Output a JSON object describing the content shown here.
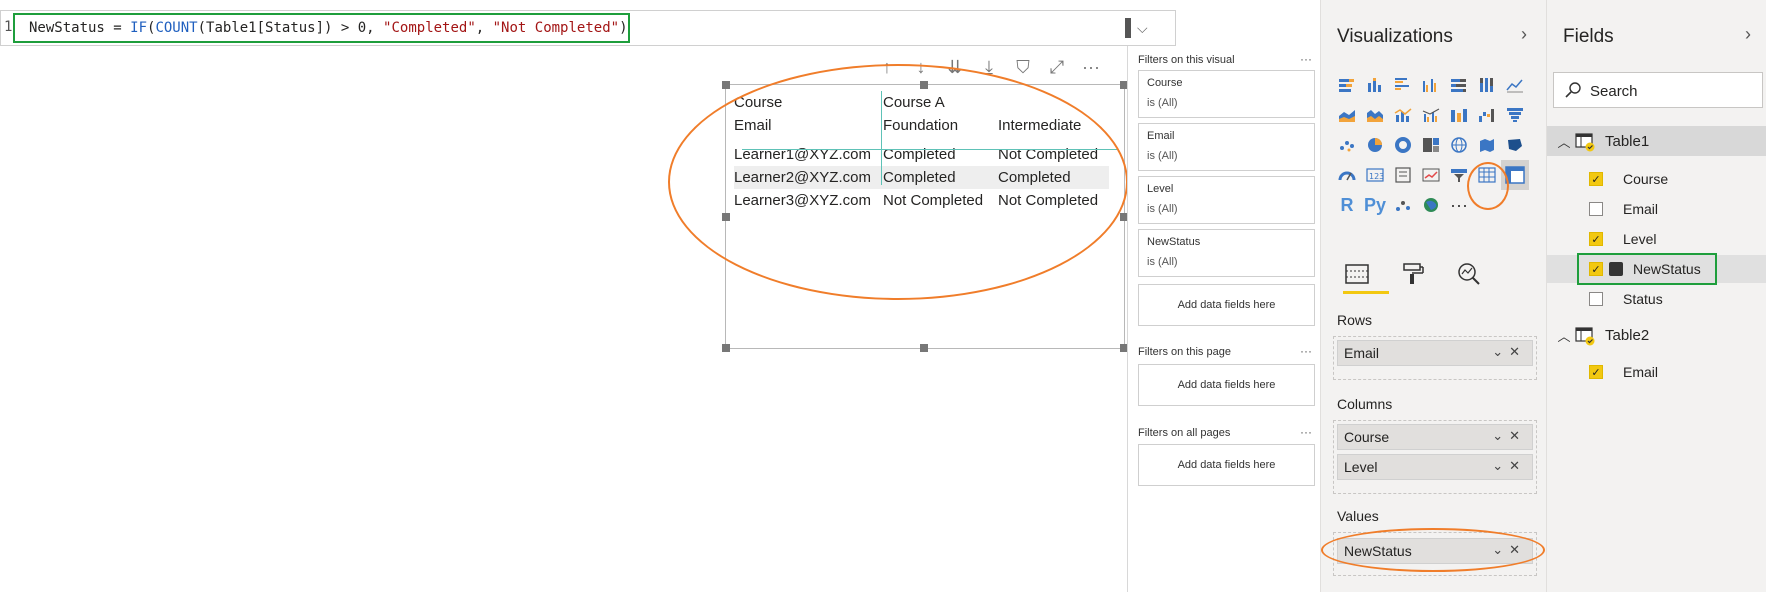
{
  "formula": {
    "line_number": "1",
    "measure_name": "NewStatus",
    "equals": " = ",
    "fn_if": "IF",
    "paren_open": "(",
    "fn_count": "COUNT",
    "count_arg": "(Table1[Status]) > 0, ",
    "str_completed": "\"Completed\"",
    "comma": ", ",
    "str_not_completed": "\"Not Completed\"",
    "paren_close": ")"
  },
  "visual_toolbar": {
    "icons": [
      "arrow-up-icon",
      "arrow-down-icon",
      "double-arrow-down-icon",
      "expand-down-icon",
      "filter-icon",
      "focus-mode-icon",
      "more-options-icon"
    ],
    "glyphs": [
      "↑",
      "↓",
      "⇊",
      "⤓",
      "⛉",
      "⤢",
      "···"
    ]
  },
  "matrix": {
    "header_row1": [
      "Course",
      "Course A",
      ""
    ],
    "header_row2": [
      "Email",
      "Foundation",
      "Intermediate"
    ],
    "rows": [
      [
        "Learner1@XYZ.com",
        "Completed",
        "Not Completed"
      ],
      [
        "Learner2@XYZ.com",
        "Completed",
        "Completed"
      ],
      [
        "Learner3@XYZ.com",
        "Not Completed",
        "Not Completed"
      ]
    ]
  },
  "filters": {
    "on_visual_title": "Filters on this visual",
    "cards": [
      {
        "name": "Course",
        "condition": "is (All)"
      },
      {
        "name": "Email",
        "condition": "is (All)"
      },
      {
        "name": "Level",
        "condition": "is (All)"
      },
      {
        "name": "NewStatus",
        "condition": "is (All)"
      }
    ],
    "add_label": "Add data fields here",
    "on_page_title": "Filters on this page",
    "on_all_pages_title": "Filters on all pages",
    "dots": "···"
  },
  "visualizations": {
    "title": "Visualizations",
    "chevron": "›",
    "more_icons": "···",
    "rows_label": "Rows",
    "rows_fields": [
      "Email"
    ],
    "columns_label": "Columns",
    "columns_fields": [
      "Course",
      "Level"
    ],
    "values_label": "Values",
    "values_fields": [
      "NewStatus"
    ],
    "field_controls": "⌄✕",
    "r_label": "R",
    "py_label": "Py"
  },
  "fields": {
    "title": "Fields",
    "chevron": "›",
    "search_placeholder": "Search",
    "tables": [
      {
        "name": "Table1",
        "fields": [
          {
            "name": "Course",
            "checked": true
          },
          {
            "name": "Email",
            "checked": false
          },
          {
            "name": "Level",
            "checked": true
          },
          {
            "name": "NewStatus",
            "checked": true,
            "calculated": true
          },
          {
            "name": "Status",
            "checked": false
          }
        ]
      },
      {
        "name": "Table2",
        "fields": [
          {
            "name": "Email",
            "checked": true
          }
        ]
      }
    ]
  },
  "colors": {
    "accent_yellow": "#f2c811",
    "highlight_orange": "#f07d2a",
    "highlight_green": "#1e9e3c"
  }
}
